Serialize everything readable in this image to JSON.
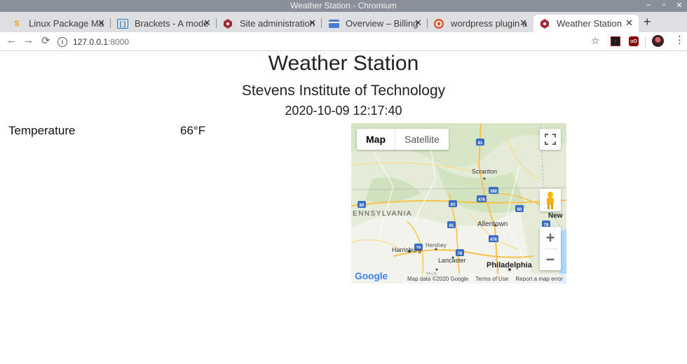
{
  "window": {
    "title": "Weather Station - Chromium"
  },
  "tabs": [
    {
      "label": "Linux Package Ma",
      "icon": "sublime-icon",
      "active": false
    },
    {
      "label": "Brackets - A mode",
      "icon": "brackets-icon",
      "active": false
    },
    {
      "label": "Site administration",
      "icon": "site-icon",
      "active": false
    },
    {
      "label": "Overview – Billing",
      "icon": "billing-icon",
      "active": false
    },
    {
      "label": "wordpress plugin a",
      "icon": "duckduckgo-icon",
      "active": false
    },
    {
      "label": "Weather Station",
      "icon": "site-icon",
      "active": true
    }
  ],
  "toolbar": {
    "url_host": "127.0.0.1",
    "url_port": ":8000"
  },
  "page": {
    "title": "Weather Station",
    "institution": "Stevens Institute of Technology",
    "datetime": "2020-10-09 12:17:40",
    "temperature_label": "Temperature",
    "temperature_value": "66°F"
  },
  "map": {
    "type_map": "Map",
    "type_satellite": "Satellite",
    "selected_type": "Map",
    "labels": {
      "scranton": "Scranton",
      "pennsylvania": "ENNSYLVANIA",
      "allentown": "Allentown",
      "harrisburg": "Harrisburg",
      "hershey": "Hershey",
      "lancaster": "Lancaster",
      "philadelphia": "Philadelphia",
      "york": "York",
      "new": "New"
    },
    "highway_shields": [
      "81",
      "380",
      "476",
      "80",
      "80",
      "78",
      "81",
      "476",
      "76",
      "83",
      "78"
    ],
    "google_logo": "Google",
    "attribution": {
      "data": "Map data ©2020 Google",
      "terms": "Terms of Use",
      "report": "Report a map error"
    }
  }
}
